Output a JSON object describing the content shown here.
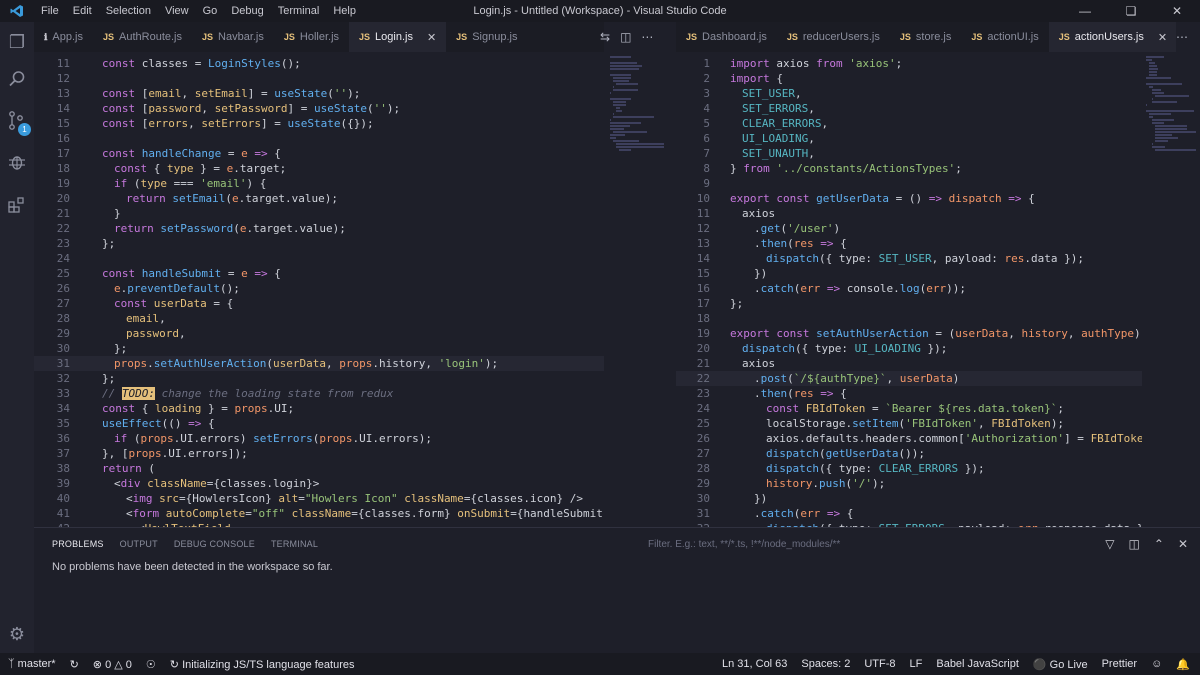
{
  "titlebar": {
    "menu": [
      "File",
      "Edit",
      "Selection",
      "View",
      "Go",
      "Debug",
      "Terminal",
      "Help"
    ],
    "title": "Login.js - Untitled (Workspace) - Visual Studio Code"
  },
  "left_tabs": [
    {
      "label": "App.js",
      "active": false
    },
    {
      "label": "AuthRoute.js",
      "active": false
    },
    {
      "label": "Navbar.js",
      "active": false
    },
    {
      "label": "Holler.js",
      "active": false
    },
    {
      "label": "Login.js",
      "active": true
    },
    {
      "label": "Signup.js",
      "active": false
    }
  ],
  "right_tabs": [
    {
      "label": "Dashboard.js",
      "active": false
    },
    {
      "label": "reducerUsers.js",
      "active": false
    },
    {
      "label": "store.js",
      "active": false
    },
    {
      "label": "actionUI.js",
      "active": false
    },
    {
      "label": "actionUsers.js",
      "active": true
    }
  ],
  "activity_badge": "1",
  "left_editor": {
    "lines": [
      {
        "n": "11",
        "html": "<span class='k'>const</span> <span class='g'>classes</span> = <span class='f'>LoginStyles</span>();",
        "indent": 0
      },
      {
        "n": "12",
        "html": "",
        "indent": 0
      },
      {
        "n": "13",
        "html": "<span class='k'>const</span> [<span class='v'>email</span>, <span class='v'>setEmail</span>] = <span class='f'>useState</span>(<span class='s'>''</span>);",
        "indent": 0
      },
      {
        "n": "14",
        "html": "<span class='k'>const</span> [<span class='v'>password</span>, <span class='v'>setPassword</span>] = <span class='f'>useState</span>(<span class='s'>''</span>);",
        "indent": 0
      },
      {
        "n": "15",
        "html": "<span class='k'>const</span> [<span class='v'>errors</span>, <span class='v'>setErrors</span>] = <span class='f'>useState</span>({});",
        "indent": 0
      },
      {
        "n": "16",
        "html": "",
        "indent": 0
      },
      {
        "n": "17",
        "html": "<span class='k'>const</span> <span class='f'>handleChange</span> = <span class='p'>e</span> <span class='k'>=&gt;</span> {",
        "indent": 0
      },
      {
        "n": "18",
        "html": "<span class='k'>const</span> { <span class='v'>type</span> } = <span class='p'>e</span>.<span class='g'>target</span>;",
        "indent": 1
      },
      {
        "n": "19",
        "html": "<span class='k'>if</span> (<span class='v'>type</span> === <span class='s'>'email'</span>) {",
        "indent": 1
      },
      {
        "n": "20",
        "html": "<span class='k'>return</span> <span class='f'>setEmail</span>(<span class='p'>e</span>.<span class='g'>target</span>.<span class='g'>value</span>);",
        "indent": 2
      },
      {
        "n": "21",
        "html": "}",
        "indent": 1
      },
      {
        "n": "22",
        "html": "<span class='k'>return</span> <span class='f'>setPassword</span>(<span class='p'>e</span>.<span class='g'>target</span>.<span class='g'>value</span>);",
        "indent": 1
      },
      {
        "n": "23",
        "html": "};",
        "indent": 0
      },
      {
        "n": "24",
        "html": "",
        "indent": 0
      },
      {
        "n": "25",
        "html": "<span class='k'>const</span> <span class='f'>handleSubmit</span> = <span class='p'>e</span> <span class='k'>=&gt;</span> {",
        "indent": 0
      },
      {
        "n": "26",
        "html": "<span class='p'>e</span>.<span class='f'>preventDefault</span>();",
        "indent": 1
      },
      {
        "n": "27",
        "html": "<span class='k'>const</span> <span class='v'>userData</span> = {",
        "indent": 1
      },
      {
        "n": "28",
        "html": "<span class='v'>email</span>,",
        "indent": 2
      },
      {
        "n": "29",
        "html": "<span class='v'>password</span>,",
        "indent": 2
      },
      {
        "n": "30",
        "html": "};",
        "indent": 1
      },
      {
        "n": "31",
        "html": "<span class='p'>props</span>.<span class='f'>setAuthUserAction</span>(<span class='v'>userData</span>, <span class='p'>props</span>.<span class='g'>history</span>, <span class='s'>'login'</span>);",
        "indent": 1,
        "current": true
      },
      {
        "n": "32",
        "html": "};",
        "indent": 0
      },
      {
        "n": "33",
        "html": "<span class='c'>// </span><span class='todo'>TODO:</span><span class='c'> change the loading state from redux</span>",
        "indent": 0
      },
      {
        "n": "34",
        "html": "<span class='k'>const</span> { <span class='v'>loading</span> } = <span class='p'>props</span>.<span class='g'>UI</span>;",
        "indent": 0
      },
      {
        "n": "35",
        "html": "<span class='f'>useEffect</span>(() <span class='k'>=&gt;</span> {",
        "indent": 0
      },
      {
        "n": "36",
        "html": "<span class='k'>if</span> (<span class='p'>props</span>.<span class='g'>UI</span>.<span class='g'>errors</span>) <span class='f'>setErrors</span>(<span class='p'>props</span>.<span class='g'>UI</span>.<span class='g'>errors</span>);",
        "indent": 1
      },
      {
        "n": "37",
        "html": "}, [<span class='p'>props</span>.<span class='g'>UI</span>.<span class='g'>errors</span>]);",
        "indent": 0
      },
      {
        "n": "38",
        "html": "<span class='k'>return</span> (",
        "indent": 0
      },
      {
        "n": "39",
        "html": "&lt;<span class='k'>div</span> <span class='y'>className</span>={<span class='g'>classes</span>.<span class='g'>login</span>}&gt;",
        "indent": 1
      },
      {
        "n": "40",
        "html": "&lt;<span class='k'>img</span> <span class='y'>src</span>={<span class='g'>HowlersIcon</span>} <span class='y'>alt</span>=<span class='s'>\"Howlers Icon\"</span> <span class='y'>className</span>={<span class='g'>classes</span>.<span class='g'>icon</span>} /&gt;",
        "indent": 2
      },
      {
        "n": "41",
        "html": "&lt;<span class='k'>form</span> <span class='y'>autoComplete</span>=<span class='s'>\"off\"</span> <span class='y'>className</span>={<span class='g'>classes</span>.<span class='g'>form</span>} <span class='y'>onSubmit</span>={<span class='g'>handleSubmit</span>}&gt;",
        "indent": 2
      },
      {
        "n": "42",
        "html": "&lt;<span class='v'>HowlTextField</span>",
        "indent": 3
      }
    ]
  },
  "right_editor": {
    "lines": [
      {
        "n": "1",
        "html": "<span class='k'>import</span> <span class='g'>axios</span> <span class='k'>from</span> <span class='s'>'axios'</span>;",
        "indent": 0
      },
      {
        "n": "2",
        "html": "<span class='k'>import</span> {",
        "indent": 0
      },
      {
        "n": "3",
        "html": "<span class='kb'>SET_USER</span>,",
        "indent": 1
      },
      {
        "n": "4",
        "html": "<span class='kb'>SET_ERRORS</span>,",
        "indent": 1
      },
      {
        "n": "5",
        "html": "<span class='kb'>CLEAR_ERRORS</span>,",
        "indent": 1
      },
      {
        "n": "6",
        "html": "<span class='kb'>UI_LOADING</span>,",
        "indent": 1
      },
      {
        "n": "7",
        "html": "<span class='kb'>SET_UNAUTH</span>,",
        "indent": 1
      },
      {
        "n": "8",
        "html": "} <span class='k'>from</span> <span class='s'>'../constants/ActionsTypes'</span>;",
        "indent": 0
      },
      {
        "n": "9",
        "html": "",
        "indent": 0
      },
      {
        "n": "10",
        "html": "<span class='k'>export</span> <span class='k'>const</span> <span class='f'>getUserData</span> = () <span class='k'>=&gt;</span> <span class='p'>dispatch</span> <span class='k'>=&gt;</span> {",
        "indent": 0
      },
      {
        "n": "11",
        "html": "<span class='g'>axios</span>",
        "indent": 1
      },
      {
        "n": "12",
        "html": ".<span class='f'>get</span>(<span class='s'>'/user'</span>)",
        "indent": 2
      },
      {
        "n": "13",
        "html": ".<span class='f'>then</span>(<span class='p'>res</span> <span class='k'>=&gt;</span> {",
        "indent": 2
      },
      {
        "n": "14",
        "html": "<span class='f'>dispatch</span>({ <span class='g'>type</span>: <span class='kb'>SET_USER</span>, <span class='g'>payload</span>: <span class='p'>res</span>.<span class='g'>data</span> });",
        "indent": 3
      },
      {
        "n": "15",
        "html": "})",
        "indent": 2
      },
      {
        "n": "16",
        "html": ".<span class='f'>catch</span>(<span class='p'>err</span> <span class='k'>=&gt;</span> <span class='g'>console</span>.<span class='f'>log</span>(<span class='p'>err</span>));",
        "indent": 2
      },
      {
        "n": "17",
        "html": "};",
        "indent": 0
      },
      {
        "n": "18",
        "html": "",
        "indent": 0
      },
      {
        "n": "19",
        "html": "<span class='k'>export</span> <span class='k'>const</span> <span class='f'>setAuthUserAction</span> = (<span class='p'>userData</span>, <span class='p'>history</span>, <span class='p'>authType</span>) <span class='k'>=&gt;</span> <span class='p'>di</span>",
        "indent": 0
      },
      {
        "n": "20",
        "html": "<span class='f'>dispatch</span>({ <span class='g'>type</span>: <span class='kb'>UI_LOADING</span> });",
        "indent": 1
      },
      {
        "n": "21",
        "html": "<span class='g'>axios</span>",
        "indent": 1
      },
      {
        "n": "22",
        "html": ".<span class='f'>post</span>(<span class='s'>`/${authType}`</span>, <span class='p'>userData</span>)",
        "indent": 2,
        "current": true
      },
      {
        "n": "23",
        "html": ".<span class='f'>then</span>(<span class='p'>res</span> <span class='k'>=&gt;</span> {",
        "indent": 2
      },
      {
        "n": "24",
        "html": "<span class='k'>const</span> <span class='v'>FBIdToken</span> = <span class='s'>`Bearer ${res.data.token}`</span>;",
        "indent": 3
      },
      {
        "n": "25",
        "html": "<span class='g'>localStorage</span>.<span class='f'>setItem</span>(<span class='s'>'FBIdToken'</span>, <span class='v'>FBIdToken</span>);",
        "indent": 3
      },
      {
        "n": "26",
        "html": "<span class='g'>axios</span>.<span class='g'>defaults</span>.<span class='g'>headers</span>.<span class='g'>common</span>[<span class='s'>'Authorization'</span>] = <span class='v'>FBIdToken</span>;",
        "indent": 3
      },
      {
        "n": "27",
        "html": "<span class='f'>dispatch</span>(<span class='f'>getUserData</span>());",
        "indent": 3
      },
      {
        "n": "28",
        "html": "<span class='f'>dispatch</span>({ <span class='g'>type</span>: <span class='kb'>CLEAR_ERRORS</span> });",
        "indent": 3
      },
      {
        "n": "29",
        "html": "<span class='p'>history</span>.<span class='f'>push</span>(<span class='s'>'/'</span>);",
        "indent": 3
      },
      {
        "n": "30",
        "html": "})",
        "indent": 2
      },
      {
        "n": "31",
        "html": ".<span class='f'>catch</span>(<span class='p'>err</span> <span class='k'>=&gt;</span> {",
        "indent": 2
      },
      {
        "n": "32",
        "html": "<span class='f'>dispatch</span>({ <span class='g'>type</span>: <span class='kb'>SET_ERRORS</span>, <span class='g'>payload</span>: <span class='p'>err</span>.<span class='g'>response</span>.<span class='g'>data</span> });",
        "indent": 3
      }
    ]
  },
  "panel": {
    "tabs": [
      "PROBLEMS",
      "OUTPUT",
      "DEBUG CONSOLE",
      "TERMINAL"
    ],
    "message": "No problems have been detected in the workspace so far.",
    "filter_placeholder": "Filter. E.g.: text, **/*.ts, !**/node_modules/**"
  },
  "status": {
    "branch": "master*",
    "errors": "0",
    "warnings": "0",
    "task": "Initializing JS/TS language features",
    "position": "Ln 31, Col 63",
    "spaces": "Spaces: 2",
    "encoding": "UTF-8",
    "eol": "LF",
    "language": "Babel JavaScript",
    "golive": "Go Live",
    "prettier": "Prettier"
  }
}
